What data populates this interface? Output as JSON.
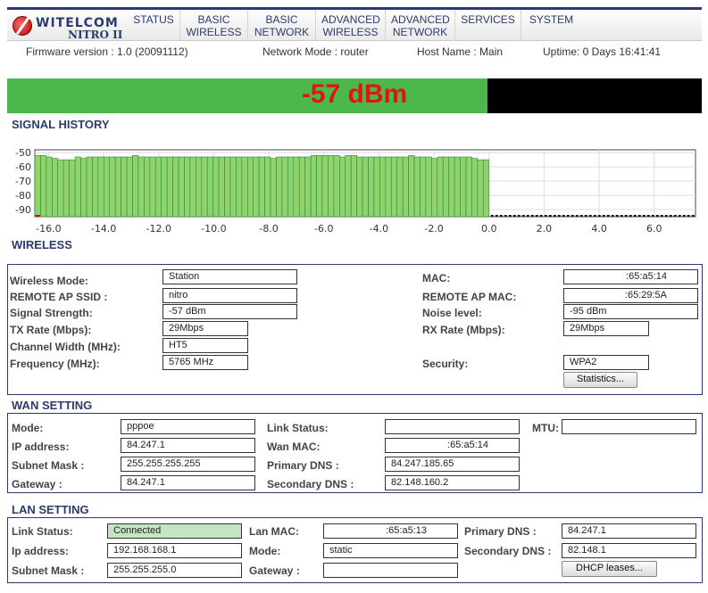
{
  "brand": {
    "name": "WITELCOM",
    "product": "NITRO II"
  },
  "nav": [
    {
      "line1": "STATUS",
      "line2": ""
    },
    {
      "line1": "BASIC",
      "line2": "WIRELESS"
    },
    {
      "line1": "BASIC",
      "line2": "NETWORK"
    },
    {
      "line1": "ADVANCED",
      "line2": "WIRELESS"
    },
    {
      "line1": "ADVANCED",
      "line2": "NETWORK"
    },
    {
      "line1": "SERVICES",
      "line2": ""
    },
    {
      "line1": "SYSTEM",
      "line2": ""
    }
  ],
  "info": {
    "firmware": "Firmware version :  1.0 (20091112)",
    "mode": "Network Mode :  router",
    "host": "Host Name :  Main",
    "uptime": "Uptime:  0 Days 16:41:41"
  },
  "signal": {
    "value_text": "-57 dBm",
    "level_fraction": 0.692,
    "fill_color": "#4cb84c",
    "text_color": "#e01515"
  },
  "sections": {
    "history": "SIGNAL HISTORY",
    "wireless": "WIRELESS",
    "wan": "WAN SETTING",
    "lan": "LAN SETTING"
  },
  "chart_data": {
    "type": "bar",
    "title": "SIGNAL HISTORY",
    "xlabel": "",
    "ylabel": "",
    "ylim": [
      -95,
      -48
    ],
    "xlim": [
      -16.5,
      7.5
    ],
    "y_ticks": [
      "-50",
      "-60",
      "-70",
      "-80",
      "-90"
    ],
    "y_tick_values": [
      -50,
      -60,
      -70,
      -80,
      -90
    ],
    "x_ticks": [
      "-16.0",
      "-14.0",
      "-12.0",
      "-10.0",
      "-8.0",
      "-6.0",
      "-4.0",
      "-2.0",
      "0.0",
      "2.0",
      "4.0",
      "6.0"
    ],
    "x_tick_values": [
      -16,
      -14,
      -12,
      -10,
      -8,
      -6,
      -4,
      -2,
      0,
      2,
      4,
      6
    ],
    "bar_color": "#8fd36f",
    "bar_edge": "#2e8b2e",
    "grid": true,
    "values": [
      -52,
      -52,
      -53,
      -54,
      -55,
      -55,
      -55,
      -53,
      -54,
      -53,
      -53,
      -53,
      -53,
      -53,
      -53,
      -53,
      -53,
      -52,
      -53,
      -53,
      -53,
      -53,
      -53,
      -53,
      -53,
      -53,
      -53,
      -53,
      -53,
      -53,
      -53,
      -53,
      -53,
      -53,
      -53,
      -53,
      -53,
      -53,
      -53,
      -53,
      -53,
      -54,
      -53,
      -53,
      -53,
      -53,
      -53,
      -53,
      -52,
      -52,
      -52,
      -52,
      -52,
      -53,
      -52,
      -52,
      -53,
      -53,
      -53,
      -53,
      -53,
      -53,
      -53,
      -53,
      -53,
      -52,
      -53,
      -53,
      -53,
      -54,
      -53,
      -53,
      -53,
      -53,
      -53,
      -53,
      -54,
      -55,
      -55
    ]
  },
  "wireless": {
    "mode_label": "Wireless Mode:",
    "mode_value": "Station",
    "ssid_label": "REMOTE AP SSID :",
    "ssid_value": "nitro",
    "strength_label": "Signal Strength:",
    "strength_value": "-57 dBm",
    "tx_label": "TX Rate (Mbps):",
    "tx_value": "29Mbps",
    "cw_label": "Channel Width (MHz):",
    "cw_value": "HT5",
    "freq_label": "Frequency (MHz):",
    "freq_value": "5765 MHz",
    "mac_label": "MAC:",
    "mac_value": ":65:a5:14",
    "apmac_label": "REMOTE AP MAC:",
    "apmac_value": ":65:29:5A",
    "noise_label": "Noise level:",
    "noise_value": "-95 dBm",
    "rx_label": "RX Rate (Mbps):",
    "rx_value": "29Mbps",
    "sec_label": "Security:",
    "sec_value": "WPA2",
    "stats_button": "Statistics..."
  },
  "wan": {
    "mode_label": "Mode:",
    "mode_value": "pppoe",
    "ip_label": "IP address:",
    "ip_value": "84.247.1",
    "mask_label": "Subnet Mask :",
    "mask_value": "255.255.255.255",
    "gw_label": "Gateway :",
    "gw_value": "84.247.1",
    "link_label": "Link Status:",
    "link_value": "",
    "mac_label": "Wan MAC:",
    "mac_value": ":65:a5:14",
    "dns1_label": "Primary DNS :",
    "dns1_value": "84.247.185.65",
    "dns2_label": "Secondary DNS :",
    "dns2_value": "82.148.160.2",
    "mtu_label": "MTU:",
    "mtu_value": ""
  },
  "lan": {
    "link_label": "Link Status:",
    "link_value": "Connected",
    "ip_label": "Ip address:",
    "ip_value": "192.168.168.1",
    "mask_label": "Subnet Mask :",
    "mask_value": "255.255.255.0",
    "mac_label": "Lan MAC:",
    "mac_value": ":65:a5:13",
    "mode_label": "Mode:",
    "mode_value": "static",
    "gw_label": "Gateway :",
    "gw_value": "",
    "dns1_label": "Primary DNS :",
    "dns1_value": "84.247.1",
    "dns2_label": "Secondary DNS :",
    "dns2_value": "82.148.1",
    "dhcp_button": "DHCP leases..."
  }
}
